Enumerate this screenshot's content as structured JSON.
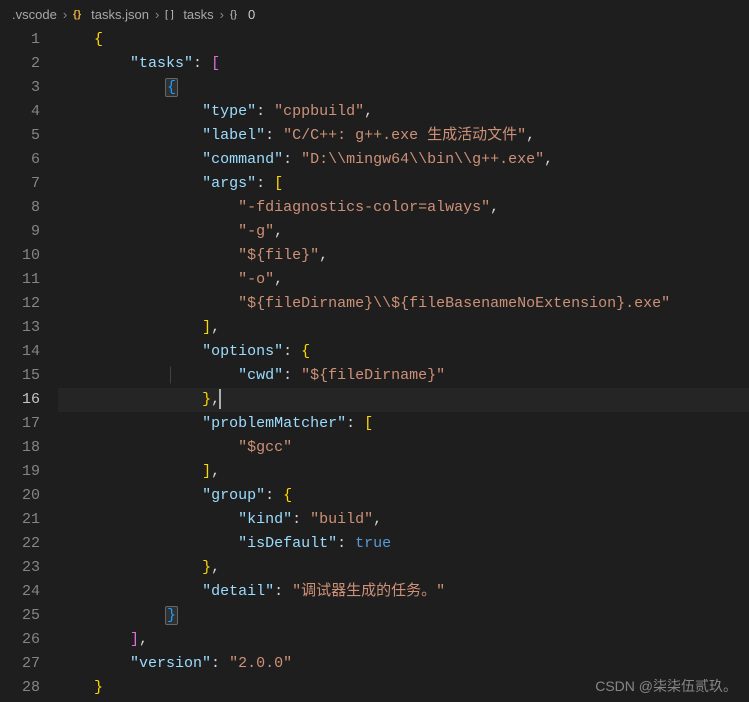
{
  "breadcrumb": {
    "items": [
      {
        "icon": "folder",
        "label": ".vscode"
      },
      {
        "icon": "json",
        "label": "tasks.json"
      },
      {
        "icon": "array",
        "label": "tasks"
      },
      {
        "icon": "object",
        "label": "0"
      }
    ]
  },
  "editor": {
    "activeLine": 16,
    "totalLines": 28,
    "lineNumbers": [
      "1",
      "2",
      "3",
      "4",
      "5",
      "6",
      "7",
      "8",
      "9",
      "10",
      "11",
      "12",
      "13",
      "14",
      "15",
      "16",
      "17",
      "18",
      "19",
      "20",
      "21",
      "22",
      "23",
      "24",
      "25",
      "26",
      "27",
      "28"
    ]
  },
  "code": {
    "keys": {
      "tasks": "\"tasks\"",
      "type": "\"type\"",
      "label": "\"label\"",
      "command": "\"command\"",
      "args": "\"args\"",
      "options": "\"options\"",
      "cwd": "\"cwd\"",
      "problemMatcher": "\"problemMatcher\"",
      "group": "\"group\"",
      "kind": "\"kind\"",
      "isDefault": "\"isDefault\"",
      "detail": "\"detail\"",
      "version": "\"version\""
    },
    "values": {
      "type": "\"cppbuild\"",
      "label": "\"C/C++: g++.exe 生成活动文件\"",
      "command": "\"D:\\\\mingw64\\\\bin\\\\g++.exe\"",
      "arg0": "\"-fdiagnostics-color=always\"",
      "arg1": "\"-g\"",
      "arg2": "\"${file}\"",
      "arg3": "\"-o\"",
      "arg4": "\"${fileDirname}\\\\${fileBasenameNoExtension}.exe\"",
      "cwd": "\"${fileDirname}\"",
      "gcc": "\"$gcc\"",
      "kind": "\"build\"",
      "isDefault": "true",
      "detail": "\"调试器生成的任务。\"",
      "version": "\"2.0.0\""
    },
    "punct": {
      "open_brace": "{",
      "close_brace": "}",
      "open_bracket": "[",
      "close_bracket": "]",
      "colon": ":",
      "comma": ",",
      "colon_space": ": "
    }
  },
  "watermark": "CSDN @柒柒伍贰玖。"
}
